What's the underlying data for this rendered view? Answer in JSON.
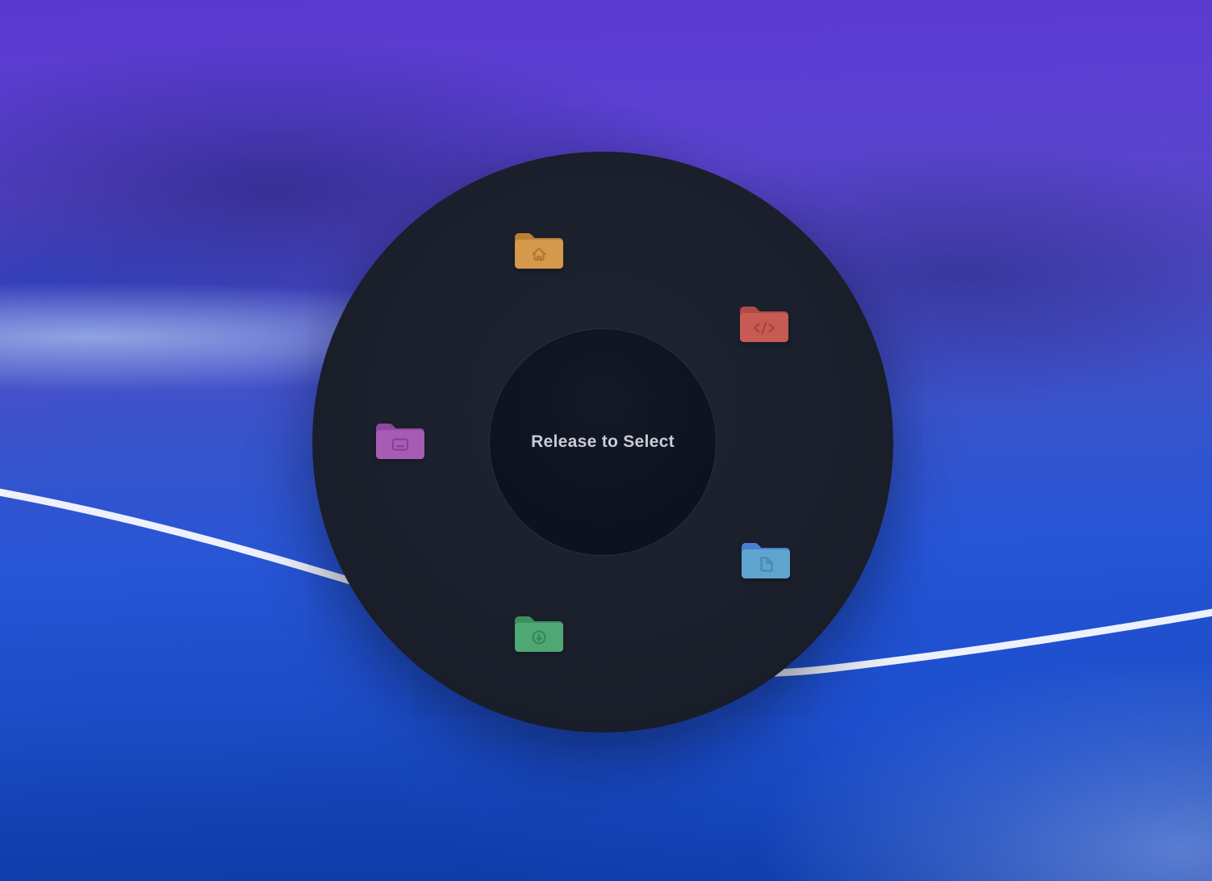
{
  "wallpaper": {
    "description": "abstract wave desktop background",
    "top_purple": "#5A38CF",
    "mid_blue": "#2E55D2",
    "deep_blue": "#0D3AA6",
    "light_band": "#96ABE4",
    "highlight_line_color": "#FFFFFF"
  },
  "menu": {
    "center_label": "Release to Select",
    "label_color": "#C8CCD4",
    "ring_color": "#1A1F2B",
    "hub_color": "#0E1220",
    "items": [
      {
        "id": "home",
        "icon": "home-icon",
        "folder_color": "#D6984B",
        "folder_dark": "#BC8034",
        "glyph_color": "#A3742F"
      },
      {
        "id": "code",
        "icon": "code-icon",
        "folder_color": "#C75B53",
        "folder_dark": "#B04A43",
        "glyph_color": "#9C413B"
      },
      {
        "id": "desktop",
        "icon": "desktop-icon",
        "folder_color": "#A75CB4",
        "folder_dark": "#8F48A0",
        "glyph_color": "#7F3E92"
      },
      {
        "id": "documents",
        "icon": "document-icon",
        "folder_color": "#5DA5CE",
        "folder_dark": "#4A7ED2",
        "glyph_color": "#4785A6"
      },
      {
        "id": "downloads",
        "icon": "download-icon",
        "folder_color": "#4FA873",
        "folder_dark": "#3D8F5F",
        "glyph_color": "#358156"
      }
    ]
  }
}
